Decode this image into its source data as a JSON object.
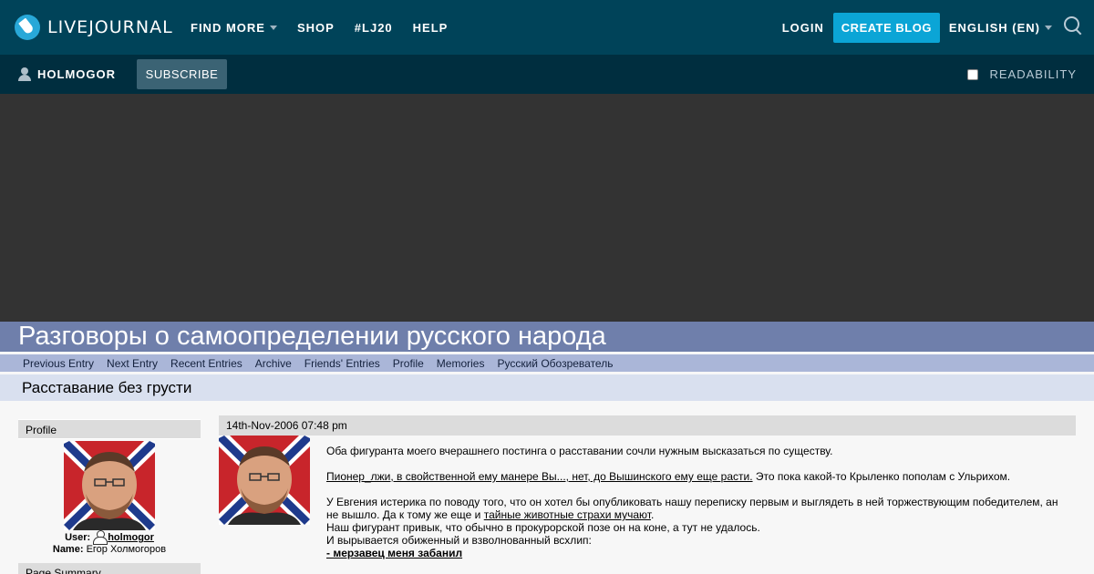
{
  "topbar": {
    "logo_text": "LIVEJOURNAL",
    "nav": [
      "FIND MORE",
      "SHOP",
      "#LJ20",
      "HELP"
    ],
    "login": "LOGIN",
    "create_blog": "CREATE BLOG",
    "language": "ENGLISH (EN)"
  },
  "subbar": {
    "username": "HOLMOGOR",
    "subscribe": "SUBSCRIBE",
    "readability": "READABILITY"
  },
  "journal": {
    "title": "Разговоры о самоопределении русского народа",
    "nav": [
      "Previous Entry",
      "Next Entry",
      "Recent Entries",
      "Archive",
      "Friends' Entries",
      "Profile",
      "Memories",
      "Русский Обозреватель"
    ],
    "entry_title": "Расставание без грусти"
  },
  "sidebar": {
    "profile_heading": "Profile",
    "user_label": "User:",
    "user_value": "holmogor",
    "name_label": "Name:",
    "name_value": "Егор Холмогоров",
    "page_summary_heading": "Page Summary"
  },
  "entry": {
    "date": "14th-Nov-2006 07:48 pm",
    "p1": "Оба фигуранта моего вчерашнего постинга о расставании сочли нужным высказаться по существу.",
    "p2_link": "Пионер_лжи, в свойственной ему манере Вы..., нет, до Вышинского ему еще расти.",
    "p2_text": " Это пока какой-то Крыленко пополам с Ульрихом.",
    "p3_line1": "У Евгения истерика по поводу того, что он хотел бы опубликовать нашу переписку первым и выглядеть в ней торжествующим победителем, ан",
    "p3_line2_pre": "не вышло. Да к тому же еще и ",
    "p3_line2_link": "тайные животные страхи мучают",
    "p3_line2_post": ".",
    "p3_line3": "Наш фигурант привык, что обычно в прокурорской позе он на коне, а тут не удалось.",
    "p3_line4": "И вырывается обиженный и взволнованный всхлип:",
    "p3_line5": "- мерзавец меня забанил"
  },
  "colors": {
    "topbar_bg": "#004359",
    "subbar_bg": "#002e3f",
    "accent": "#0ba5d6",
    "journal_title_bg": "#6f7fab",
    "journal_nav_bg": "#aab6d8",
    "entry_title_bg": "#d9e0ef"
  }
}
